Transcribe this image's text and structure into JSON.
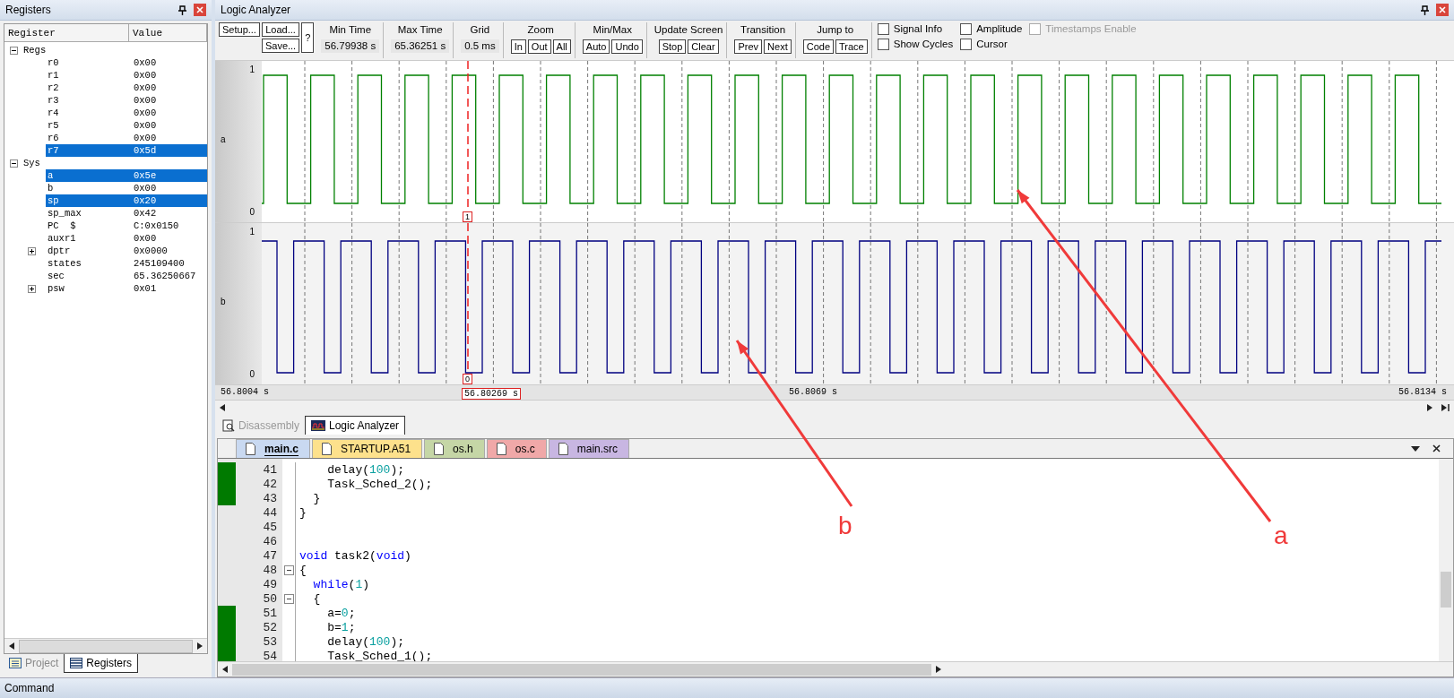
{
  "registers_panel": {
    "title": "Registers",
    "columns": [
      "Register",
      "Value"
    ],
    "tree": [
      {
        "name": "Regs",
        "expanded": true,
        "children": [
          {
            "name": "r0",
            "value": "0x00",
            "selected": false
          },
          {
            "name": "r1",
            "value": "0x00",
            "selected": false
          },
          {
            "name": "r2",
            "value": "0x00",
            "selected": false
          },
          {
            "name": "r3",
            "value": "0x00",
            "selected": false
          },
          {
            "name": "r4",
            "value": "0x00",
            "selected": false
          },
          {
            "name": "r5",
            "value": "0x00",
            "selected": false
          },
          {
            "name": "r6",
            "value": "0x00",
            "selected": false
          },
          {
            "name": "r7",
            "value": "0x5d",
            "selected": true
          }
        ]
      },
      {
        "name": "Sys",
        "expanded": true,
        "children": [
          {
            "name": "a",
            "value": "0x5e",
            "selected": true
          },
          {
            "name": "b",
            "value": "0x00",
            "selected": false
          },
          {
            "name": "sp",
            "value": "0x20",
            "selected": true
          },
          {
            "name": "sp_max",
            "value": "0x42",
            "selected": false
          },
          {
            "name": "PC  $",
            "value": "C:0x0150",
            "selected": false
          },
          {
            "name": "auxr1",
            "value": "0x00",
            "selected": false
          },
          {
            "name": "dptr",
            "value": "0x0000",
            "selected": false,
            "expanded": false
          },
          {
            "name": "states",
            "value": "245109400",
            "selected": false
          },
          {
            "name": "sec",
            "value": "65.36250667",
            "selected": false
          },
          {
            "name": "psw",
            "value": "0x01",
            "selected": false,
            "expanded": false
          }
        ]
      }
    ],
    "tabs": [
      {
        "label": "Project",
        "selected": false
      },
      {
        "label": "Registers",
        "selected": true
      }
    ]
  },
  "logic_analyzer": {
    "title": "Logic Analyzer",
    "toolbar": {
      "setup": "Setup...",
      "load": "Load...",
      "save": "Save...",
      "help": "?",
      "fields": [
        {
          "label": "Min Time",
          "value": "56.79938 s"
        },
        {
          "label": "Max Time",
          "value": "65.36251 s"
        },
        {
          "label": "Grid",
          "value": "0.5 ms"
        }
      ],
      "groups": [
        {
          "label": "Zoom",
          "buttons": [
            "In",
            "Out",
            "All"
          ]
        },
        {
          "label": "Min/Max",
          "buttons": [
            "Auto",
            "Undo"
          ]
        },
        {
          "label": "Update Screen",
          "buttons": [
            "Stop",
            "Clear"
          ]
        },
        {
          "label": "Transition",
          "buttons": [
            "Prev",
            "Next"
          ]
        },
        {
          "label": "Jump to",
          "buttons": [
            "Code",
            "Trace"
          ]
        }
      ],
      "checkbox_columns": [
        [
          {
            "label": "Signal Info",
            "checked": false,
            "disabled": false
          },
          {
            "label": "Show Cycles",
            "checked": false,
            "disabled": false
          }
        ],
        [
          {
            "label": "Amplitude",
            "checked": false,
            "disabled": false
          },
          {
            "label": "Cursor",
            "checked": false,
            "disabled": false
          }
        ],
        [
          {
            "label": "Timestamps Enable",
            "checked": false,
            "disabled": true
          }
        ]
      ]
    },
    "signals": [
      {
        "name": "a",
        "high": "1",
        "low": "0",
        "color": "#008000",
        "cursor_marker": "1"
      },
      {
        "name": "b",
        "high": "1",
        "low": "0",
        "color": "#000080",
        "cursor_marker": "0"
      }
    ],
    "time_axis": {
      "start": "56.8004 s",
      "middle": "56.8069 s",
      "end": "56.8134 s",
      "cursor": "56.80269 s"
    }
  },
  "view_tabs": [
    {
      "label": "Disassembly",
      "selected": false
    },
    {
      "label": "Logic Analyzer",
      "selected": true
    }
  ],
  "file_tabs": [
    {
      "label": "main.c",
      "selected": true,
      "color": "#c9d9f1"
    },
    {
      "label": "STARTUP.A51",
      "selected": false,
      "color": "#fde18c"
    },
    {
      "label": "os.h",
      "selected": false,
      "color": "#c5d6a6"
    },
    {
      "label": "os.c",
      "selected": false,
      "color": "#f0a8a8"
    },
    {
      "label": "main.src",
      "selected": false,
      "color": "#c8b6e2"
    }
  ],
  "code": [
    {
      "number": "41",
      "executed": true,
      "fold": false,
      "tokens": [
        {
          "text": "    delay("
        },
        {
          "number": "100"
        },
        {
          "text": ");"
        }
      ]
    },
    {
      "number": "42",
      "executed": true,
      "fold": false,
      "tokens": [
        {
          "text": "    Task_Sched_2();"
        }
      ]
    },
    {
      "number": "43",
      "executed": true,
      "fold": false,
      "tokens": [
        {
          "text": "  }"
        }
      ]
    },
    {
      "number": "44",
      "executed": false,
      "fold": false,
      "tokens": [
        {
          "text": "}"
        }
      ]
    },
    {
      "number": "45",
      "executed": false,
      "fold": false
    },
    {
      "number": "46",
      "executed": false,
      "fold": false
    },
    {
      "number": "47",
      "executed": false,
      "fold": false,
      "tokens": [
        {
          "keyword": "void"
        },
        {
          "text": " task2("
        },
        {
          "keyword": "void"
        },
        {
          "text": ")"
        }
      ]
    },
    {
      "number": "48",
      "executed": false,
      "fold": true,
      "tokens": [
        {
          "text": "{"
        }
      ]
    },
    {
      "number": "49",
      "executed": false,
      "fold": false,
      "tokens": [
        {
          "keyword": "  while"
        },
        {
          "text": "("
        },
        {
          "number": "1"
        },
        {
          "text": ")"
        }
      ]
    },
    {
      "number": "50",
      "executed": false,
      "fold": true,
      "tokens": [
        {
          "text": "  {"
        }
      ]
    },
    {
      "number": "51",
      "executed": true,
      "fold": false,
      "tokens": [
        {
          "text": "    a="
        },
        {
          "number": "0"
        },
        {
          "text": ";"
        }
      ]
    },
    {
      "number": "52",
      "executed": true,
      "fold": false,
      "tokens": [
        {
          "text": "    b="
        },
        {
          "number": "1"
        },
        {
          "text": ";"
        }
      ]
    },
    {
      "number": "53",
      "executed": true,
      "fold": false,
      "tokens": [
        {
          "text": "    delay("
        },
        {
          "number": "100"
        },
        {
          "text": ");"
        }
      ]
    },
    {
      "number": "54",
      "executed": true,
      "fold": false,
      "tokens": [
        {
          "text": "    Task_Sched_1();"
        }
      ]
    }
  ],
  "command_bar": {
    "title": "Command"
  },
  "annotations": [
    {
      "label": "b"
    },
    {
      "label": "a"
    }
  ]
}
